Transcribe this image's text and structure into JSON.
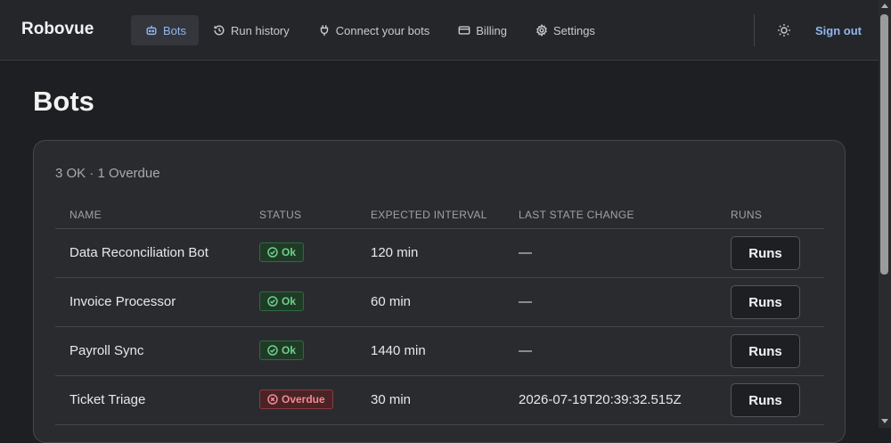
{
  "app": {
    "brand": "Robovue"
  },
  "nav": {
    "items": [
      {
        "label": "Bots",
        "icon": "bot-icon"
      },
      {
        "label": "Run history",
        "icon": "history-icon"
      },
      {
        "label": "Connect your bots",
        "icon": "plug-icon"
      },
      {
        "label": "Billing",
        "icon": "credit-card-icon"
      },
      {
        "label": "Settings",
        "icon": "gear-icon"
      }
    ],
    "theme_icon": "sun-icon",
    "sign_out": "Sign out"
  },
  "page": {
    "title": "Bots",
    "summary": "3 OK · 1 Overdue"
  },
  "table": {
    "columns": [
      "NAME",
      "STATUS",
      "EXPECTED INTERVAL",
      "LAST STATE CHANGE",
      "RUNS"
    ],
    "rows": [
      {
        "name": "Data Reconciliation Bot",
        "status": "Ok",
        "interval": "120 min",
        "last_change": "—",
        "runs": "Runs"
      },
      {
        "name": "Invoice Processor",
        "status": "Ok",
        "interval": "60 min",
        "last_change": "—",
        "runs": "Runs"
      },
      {
        "name": "Payroll Sync",
        "status": "Ok",
        "interval": "1440 min",
        "last_change": "—",
        "runs": "Runs"
      },
      {
        "name": "Ticket Triage",
        "status": "Overdue",
        "interval": "30 min",
        "last_change": "2026-07-19T20:39:32.515Z",
        "runs": "Runs"
      }
    ]
  },
  "colors": {
    "accent": "#8fb6f0",
    "ok": "#6fd08a",
    "overdue": "#f08a8f"
  }
}
